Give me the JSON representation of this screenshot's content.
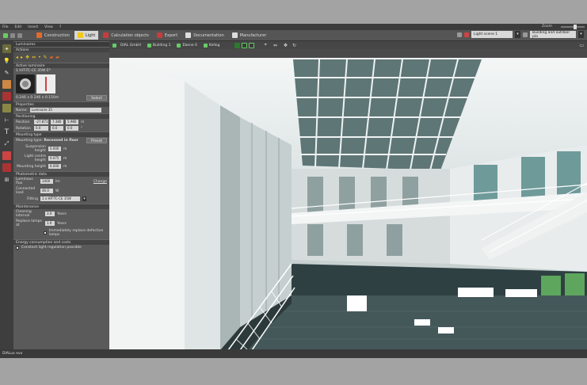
{
  "menu": [
    "File",
    "Edit",
    "Insert",
    "View",
    "?"
  ],
  "zoom_label": "Zoom",
  "tabs": [
    {
      "label": "Construction",
      "color": "#e06b2a"
    },
    {
      "label": "Light",
      "color": "#f2c81b",
      "active": true
    },
    {
      "label": "Calculation objects",
      "color": "#c83c3c"
    },
    {
      "label": "Export",
      "color": "#c83c3c"
    },
    {
      "label": "Documentation",
      "color": "#dddddd"
    },
    {
      "label": "Manufacturer",
      "color": "#dddddd"
    }
  ],
  "light_scene": "Light scene 1",
  "building_select": "Building and outdoor pla",
  "view_tabs": [
    "DIAL GmbH",
    "Building 1",
    "Ebene 0",
    "Kellog"
  ],
  "panel": {
    "luminaire_header": "Luminaires",
    "actions_header": "Actions",
    "active_header": "Active luminaire",
    "active_name": "1 HIT-TC-CE 35W E*",
    "dims": "0.246 x 0.246 x 0.150m",
    "select_btn": "Select",
    "properties_header": "Properties",
    "name_label": "Name:",
    "name_value": "Luminaire 35",
    "position_header": "Positioning",
    "position_label": "Position",
    "pos_x": "-27.871",
    "pos_y": "7.380",
    "pos_z": "5.980",
    "unit_m": "m",
    "rotation_label": "Rotation",
    "rot_x": "0.0",
    "rot_y": "0.0",
    "rot_z": "0.0",
    "mounting_header": "Mounting type",
    "mounting_label": "Mounting type:",
    "mounting_value": "Recessed in floor",
    "preset_btn": "Preset",
    "susp_label": "Suspension height",
    "susp_value": "0.000",
    "lc_label": "Light centre height",
    "lc_value": "0.075",
    "mh_label": "Mounting height",
    "mh_value": "6.000",
    "photometric_header": "Photometric data",
    "flux_label": "Luminous flux",
    "flux_value": "3400",
    "flux_unit": "lm",
    "change_link": "Change",
    "load_label": "Connected load",
    "load_value": "46.0",
    "load_unit": "W",
    "fitting_label": "Fitting",
    "fitting_value": "1 x HIT-TC-CE  35W",
    "maintenance_header": "Maintenance",
    "clean_label": "Cleaning interval",
    "clean_value": "3.0",
    "clean_unit": "Years",
    "replace_label": "Replace lamps at",
    "replace_value": "1.0",
    "replace_unit": "Years",
    "immediate_label": "Immediately replace defective lamps",
    "energy_header": "Energy consumption and costs",
    "constant_label": "Constant light regulation possible"
  },
  "status": "DIALux evo"
}
